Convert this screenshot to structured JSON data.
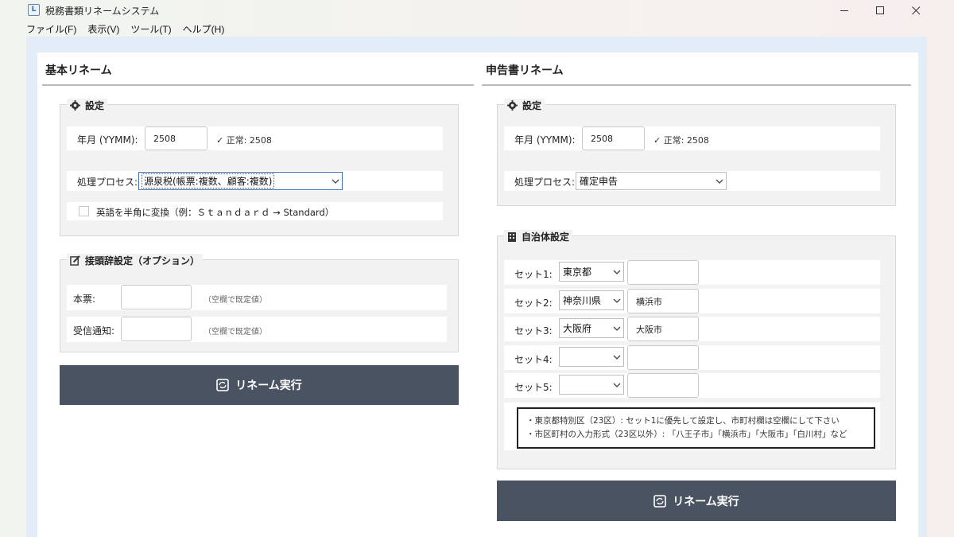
{
  "window": {
    "title": "税務書類リネームシステム",
    "icon_glyph": "L"
  },
  "menu": [
    "ファイル(F)",
    "表示(V)",
    "ツール(T)",
    "ヘルプ(H)"
  ],
  "basic": {
    "title": "基本リネーム",
    "settings": {
      "legend": "設定",
      "ym_label": "年月 (YYMM):",
      "ym_value": "2508",
      "ym_status": "✓ 正常: 2508",
      "process_label": "処理プロセス:",
      "process_value": "源泉税(帳票:複数、顧客:複数)",
      "convert_label": "英語を半角に変換（例：Ｓｔａｎｄａｒｄ → Standard）",
      "convert_checked": false
    },
    "prefix": {
      "legend": "接頭辞設定（オプション）",
      "main_label": "本票:",
      "main_value": "",
      "main_hint": "（空欄で既定値）",
      "recv_label": "受信通知:",
      "recv_value": "",
      "recv_hint": "（空欄で既定値）"
    },
    "exec_label": "リネーム実行"
  },
  "return": {
    "title": "申告書リネーム",
    "settings": {
      "legend": "設定",
      "ym_label": "年月 (YYMM):",
      "ym_value": "2508",
      "ym_status": "✓ 正常: 2508",
      "process_label": "処理プロセス:",
      "process_value": "確定申告"
    },
    "municipal": {
      "legend": "自治体設定",
      "sets": [
        {
          "label": "セット1:",
          "pref": "東京都",
          "city": ""
        },
        {
          "label": "セット2:",
          "pref": "神奈川県",
          "city": "横浜市"
        },
        {
          "label": "セット3:",
          "pref": "大阪府",
          "city": "大阪市"
        },
        {
          "label": "セット4:",
          "pref": "",
          "city": ""
        },
        {
          "label": "セット5:",
          "pref": "",
          "city": ""
        }
      ],
      "notes": [
        "・東京都特別区（23区）: セット1に優先して設定し、市町村欄は空欄にして下さい",
        "・市区町村の入力形式（23区以外）: 「八王子市」「横浜市」「大阪市」「白川村」など"
      ]
    },
    "exec_label": "リネーム実行"
  },
  "icons": {
    "settings": "gear-icon",
    "prefix": "edit-icon",
    "municipal": "building-icon",
    "exec": "rename-icon",
    "dropdown": "chevron-down-icon"
  }
}
